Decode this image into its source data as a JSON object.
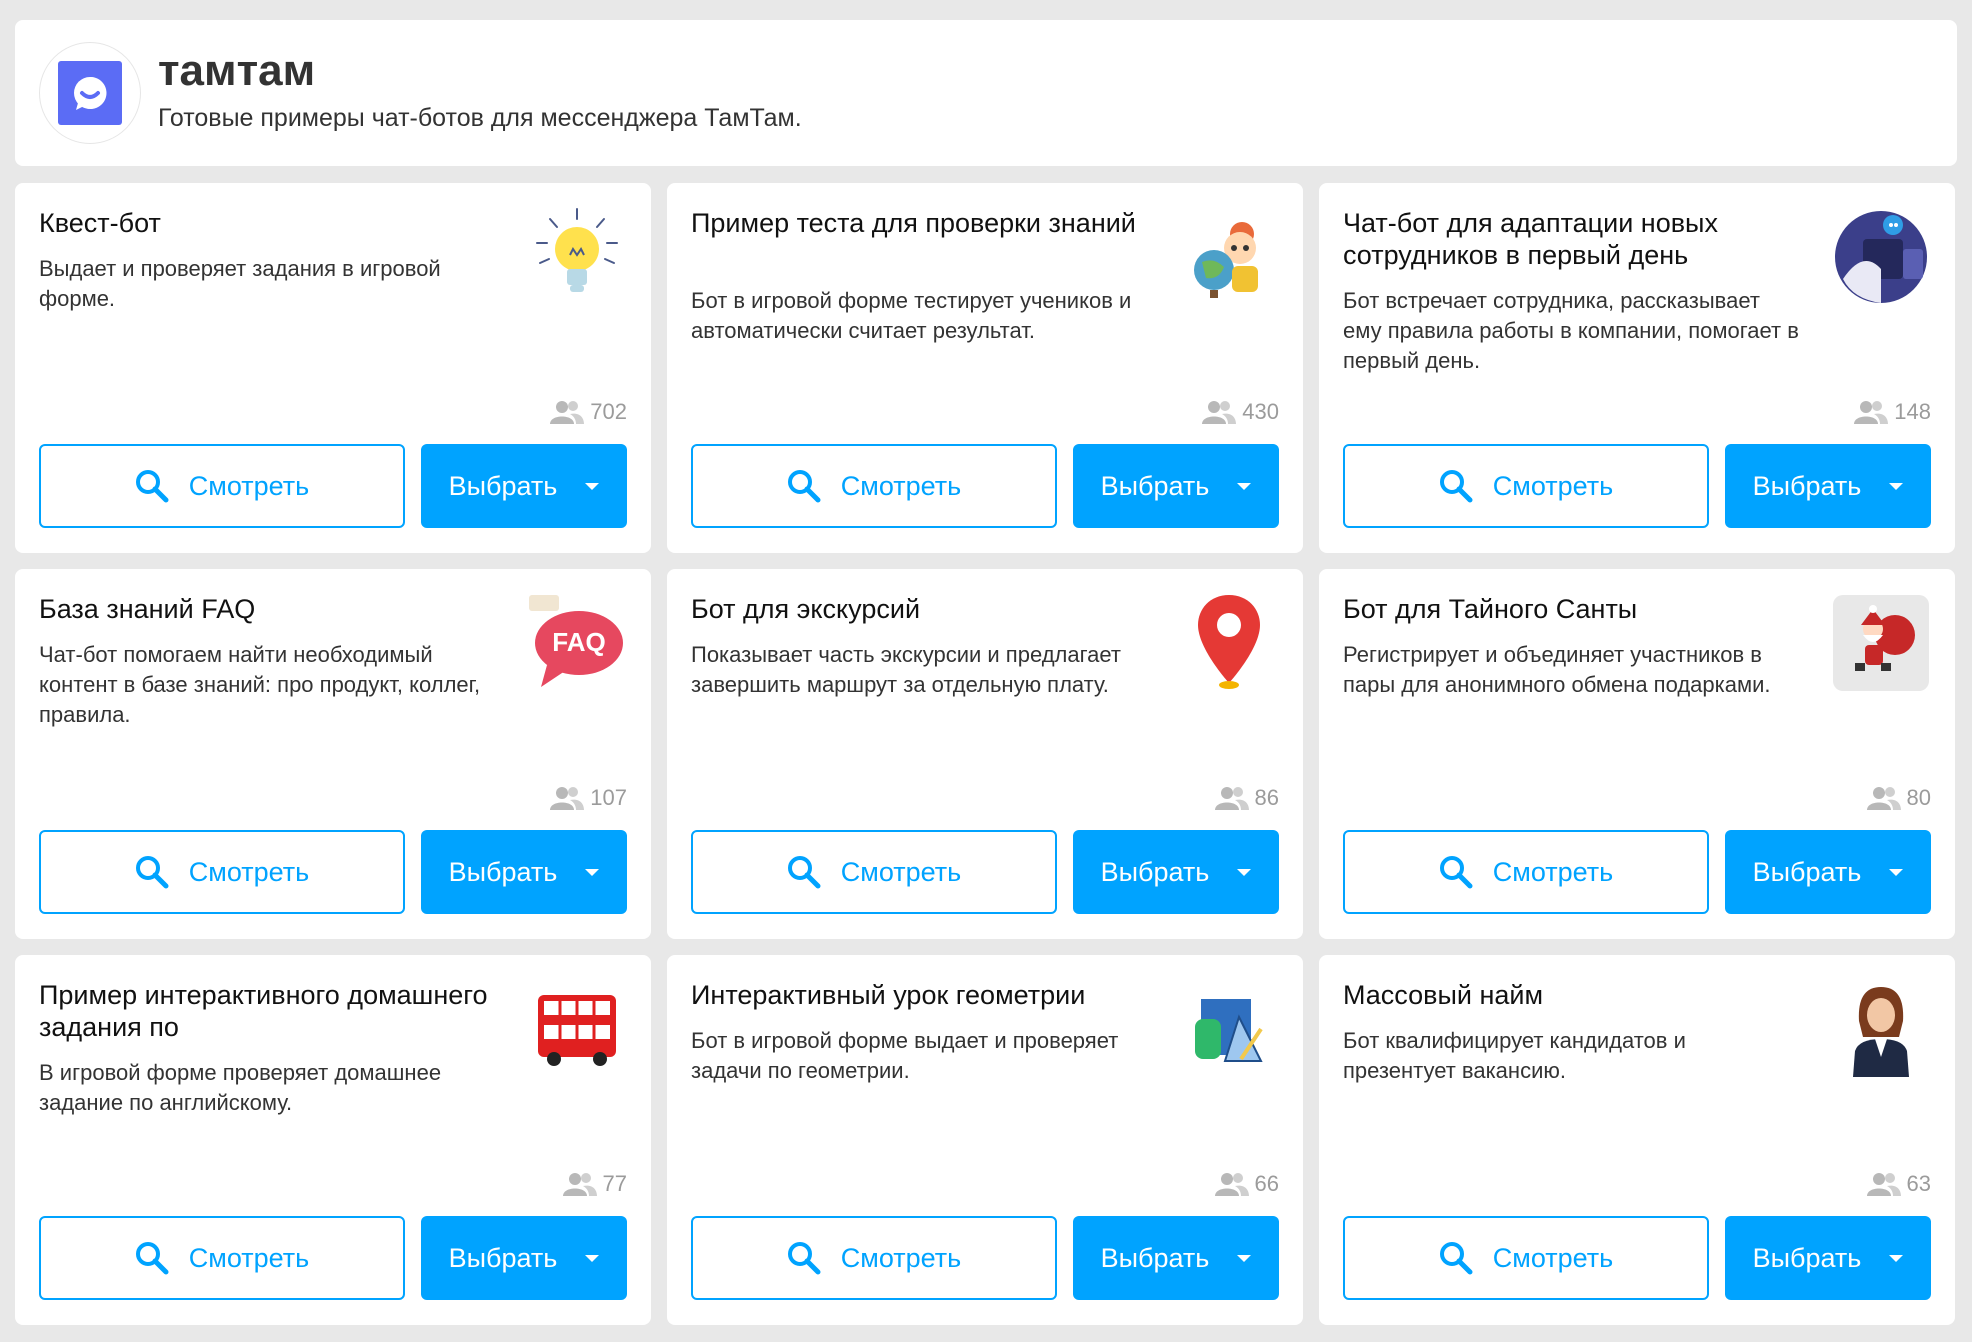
{
  "header": {
    "title": "тамтам",
    "subtitle": "Готовые примеры чат-ботов для мессенджера ТамТам.",
    "brand_color": "#5b6cf5"
  },
  "accent_color": "#00a3ff",
  "cards": [
    {
      "title": "Квест-бот",
      "description": "Выдает и проверяет задания в игровой форме.",
      "users": "702",
      "image": "lightbulb-icon",
      "view_label": "Смотреть",
      "pick_label": "Выбрать"
    },
    {
      "title": "Пример теста для проверки знаний",
      "description": "Бот в игровой форме тестирует учеников и автоматически считает результат.",
      "users": "430",
      "image": "student-globe-icon",
      "view_label": "Смотреть",
      "pick_label": "Выбрать"
    },
    {
      "title": "Чат-бот для адаптации новых сотрудников в первый день",
      "description": "Бот встречает сотрудника, рассказывает ему правила работы в компании, помогает в первый день.",
      "users": "148",
      "image": "onboarding-icon",
      "view_label": "Смотреть",
      "pick_label": "Выбрать"
    },
    {
      "title": "База знаний FAQ",
      "description": "Чат-бот помогаем найти необходимый контент в базе знаний: про продукт, коллег, правила.",
      "users": "107",
      "image": "faq-bubble-icon",
      "view_label": "Смотреть",
      "pick_label": "Выбрать"
    },
    {
      "title": "Бот для экскурсий",
      "description": "Показывает часть экскурсии и предлагает завершить маршрут за отдельную плату.",
      "users": "86",
      "image": "map-pin-icon",
      "view_label": "Смотреть",
      "pick_label": "Выбрать"
    },
    {
      "title": "Бот для Тайного Санты",
      "description": "Регистрирует и объединяет участников в пары для анонимного обмена подарками.",
      "users": "80",
      "image": "santa-icon",
      "view_label": "Смотреть",
      "pick_label": "Выбрать"
    },
    {
      "title": "Пример интерактивного домашнего задания по",
      "description": "В игровой форме проверяет домашнее задание по английскому.",
      "users": "77",
      "image": "double-decker-bus-icon",
      "view_label": "Смотреть",
      "pick_label": "Выбрать"
    },
    {
      "title": "Интерактивный урок геометрии",
      "description": "Бот в игровой форме выдает и проверяет задачи по геометрии.",
      "users": "66",
      "image": "geometry-shapes-icon",
      "view_label": "Смотреть",
      "pick_label": "Выбрать"
    },
    {
      "title": "Массовый найм",
      "description": "Бот квалифицирует кандидатов и презентует вакансию.",
      "users": "63",
      "image": "businesswoman-icon",
      "view_label": "Смотреть",
      "pick_label": "Выбрать"
    }
  ]
}
